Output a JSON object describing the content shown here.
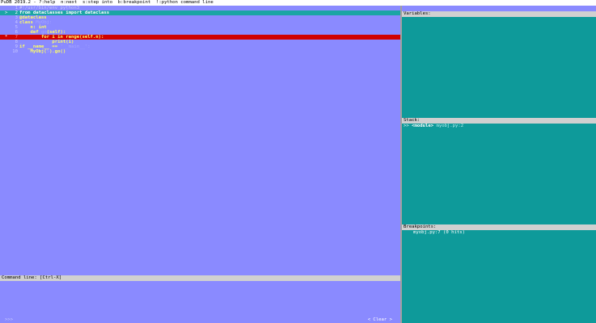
{
  "top_bar": "PuDB 2019.2 - ?:help  n:next  s:step into  b:breakpoint  !:python command line",
  "source": {
    "lines": [
      {
        "num": "1",
        "marker": "",
        "state": "normal",
        "parts": [
          {
            "t": "#!/usr/bin/env python3",
            "c": "cmt"
          }
        ]
      },
      {
        "num": "2",
        "marker": ">",
        "state": "current",
        "parts": [
          {
            "t": "from dataclasses import dataclass",
            "c": "w"
          }
        ]
      },
      {
        "num": "3",
        "marker": "",
        "state": "normal",
        "parts": [
          {
            "t": "@dataclass",
            "c": "k"
          }
        ]
      },
      {
        "num": "4",
        "marker": "",
        "state": "normal",
        "parts": [
          {
            "t": "class ",
            "c": "k"
          },
          {
            "t": "MyObj:",
            "c": "d"
          }
        ]
      },
      {
        "num": "5",
        "marker": "",
        "state": "normal",
        "parts": [
          {
            "t": "    n: int",
            "c": "k"
          }
        ]
      },
      {
        "num": "6",
        "marker": "",
        "state": "normal",
        "parts": [
          {
            "t": "    def ",
            "c": "k"
          },
          {
            "t": "go",
            "c": "d"
          },
          {
            "t": "(self):",
            "c": "k"
          }
        ]
      },
      {
        "num": "7",
        "marker": "*",
        "state": "breakpoint",
        "parts": [
          {
            "t": "        for i in range(self.n):",
            "c": "k"
          }
        ]
      },
      {
        "num": "8",
        "marker": "",
        "state": "normal",
        "parts": [
          {
            "t": "            print(i)",
            "c": "k"
          }
        ]
      },
      {
        "num": "9",
        "marker": "",
        "state": "normal",
        "parts": [
          {
            "t": "if ",
            "c": "k"
          },
          {
            "t": "__name__",
            "c": "k"
          },
          {
            "t": " == ",
            "c": "k"
          },
          {
            "t": "'__main__':",
            "c": "d"
          }
        ]
      },
      {
        "num": "10",
        "marker": "",
        "state": "normal",
        "parts": [
          {
            "t": "    MyObj(",
            "c": "k"
          },
          {
            "t": "5",
            "c": "d"
          },
          {
            "t": ").go()",
            "c": "k"
          }
        ]
      }
    ]
  },
  "command_line": {
    "label": "Command line: [Ctrl-X]",
    "prompt": ">>>",
    "clear_label": "< Clear >"
  },
  "variables": {
    "label": "Variables:"
  },
  "stack": {
    "label": "Stack:",
    "rows": [
      {
        "marker": ">>",
        "function": "<module>",
        "location": "myobj.py:2"
      }
    ]
  },
  "breakpoints": {
    "label": "Breakpoints:",
    "rows": [
      {
        "text": "myobj.py:7 (0 hits)"
      }
    ]
  },
  "colors": {
    "source_bg": "#8a8aff",
    "panel_bg": "#0e9a9a",
    "current_line": "#1ba5a5",
    "breakpoint_line": "#d00000"
  }
}
